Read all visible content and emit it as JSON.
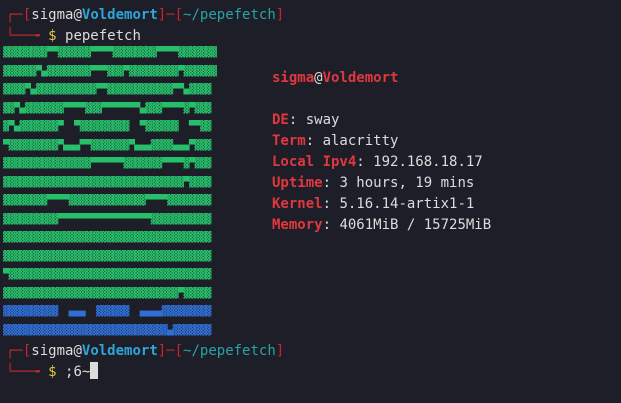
{
  "prompt1": {
    "bracket_open": "┌─[",
    "user": "sigma",
    "at": "@",
    "host": "Voldemort",
    "sep": "]─[",
    "path": "~/pepefetch",
    "bracket_close": "]",
    "line2_prefix": "└──╼ ",
    "dollar": "$",
    "command": " pepefetch"
  },
  "ascii_art": {
    "rows": [
      "▓▓▓▓▓▓▓▓▀▀▓▓▓▓▓▓▀▀▀▀▓▓▓▓▓▓▓▓▀▀▀▀▓▓▓▓▓▓▓",
      "▓▓▓▓▓▓▀▄▓▓▓▓▓▓▓▓▀▀▀▓▓▓▀▓▓▓▓▓▓▓▓▓▀▓▓▓▓▓▓",
      "▓▓▓▓▀▄▓▓▓▓▓▓▓▓▓▓▓▀▀▓▓▓▓▓▓▓▓▓▓▓▓▀▀▄▓▓▓▓",
      "▓▓▀▄▓▓▓▓▓▓▓▀▀▀▀▓▓▓▀▀▀▀▀▀▀▄▓▓▓▀▀▀▀▓▀▓▓▓",
      "▓▀▄▓▓▓▓▓▓▓▀  ▀▓▓▓▓▓▓▓▓▓  ▀▓▓▓▓▓▓  ▀▀▓▓",
      "▀▓▓▓▓▓▓▓▓▓▀▄▄▄▀▀▓▓▓▓▓▓▓▀▄▄▄▓▓▓▓▄▄▄▀▓▓▓",
      "▓▓▓▓▓▓▓▓▓▓▓▓▓▓▓▓▀▀▀▀▀▀▓▓▓▓▓▓▓▀▀▀▀▓▀▓▓▓",
      "▓▓▓▓▓▓▓▓▓▓▓▓▓▓▓▓▓▓▓▓▓▓▓▓▓▓▓▓▓▓▓▓▓▀▓▓▓▓",
      "▓▓▓▓▓▓▓▓▀▀▀▀▓▓▓▓▓▓▓▓▓▓▓▓▓▓▀▀▀▀▓▓▓▓▓▓▓▓",
      "▓▓▓▓▓▓▓▓▓▓▀▀▀▀▀▀▀▀▀▀▀▀▀▀▀▀▀▓▓▓▓▓▓▓▓▓▓▓",
      "▓▓▓▓▓▓▓▓▓▓▓▓▓▓▓▓▓▓▓▓▓▓▓▓▓▓▓▓▓▓▓▓▓▓▓▓▓▓",
      "▓▓▓▓▓▓▓▓▓▓▓▓▓▓▓▓▓▓▓▓▓▓▓▓▓▓▓▓▓▓▓▓▓▓▓▓▓▓",
      "▀▓▓▓▓▓▓▓▓▓▓▓▓▓▓▓▓▓▓▓▓▓▓▓▓▓▓▓▓▓▓▓▓▓▓▓▓▓",
      "▓▓▓▓▓▓▓▓▓▓▓▓▓▓▓▓▓▓▓▓▓▓▓▓▓▓▓▓▓▓▓▓▀▓▓▓▓▓",
      "▓▓▓▓▓▓▓▓▓▓  ▄▄▄  ▓▓▓▓▓▓  ▄▄▄▄▓▓▓▓▓▓▓▓▓",
      "▓▓▓▓▓▓▓▓▓▓▓▓▓▓▓▓▓▓▓▓▓▓▓▓▓▓▓▓▓▓▄▓▓▓▓▓▓▓"
    ],
    "blue_rows": [
      14,
      15
    ]
  },
  "info": {
    "user": "sigma",
    "at": "@",
    "host": "Voldemort",
    "fields": [
      {
        "key": "DE",
        "value": "sway"
      },
      {
        "key": "Term",
        "value": "alacritty"
      },
      {
        "key": "Local Ipv4",
        "value": "192.168.18.17"
      },
      {
        "key": "Uptime",
        "value": "3 hours, 19 mins"
      },
      {
        "key": "Kernel",
        "value": "5.16.14-artix1-1"
      },
      {
        "key": "Memory",
        "value": "4061MiB / 15725MiB"
      }
    ]
  },
  "prompt2": {
    "bracket_open": "┌─[",
    "user": "sigma",
    "at": "@",
    "host": "Voldemort",
    "sep": "]─[",
    "path": "~/pepefetch",
    "bracket_close": "]",
    "line2_prefix": "└──╼ ",
    "dollar": "$",
    "typed": " ;6~"
  },
  "colors": {
    "background": "#1e1e28",
    "red": "#e0383e",
    "blue_host": "#2fa6d8",
    "teal_path": "#27a4a8",
    "yellow_dollar": "#e8c33a",
    "green_art": "#26c06a",
    "blue_art": "#2f6fd6"
  }
}
